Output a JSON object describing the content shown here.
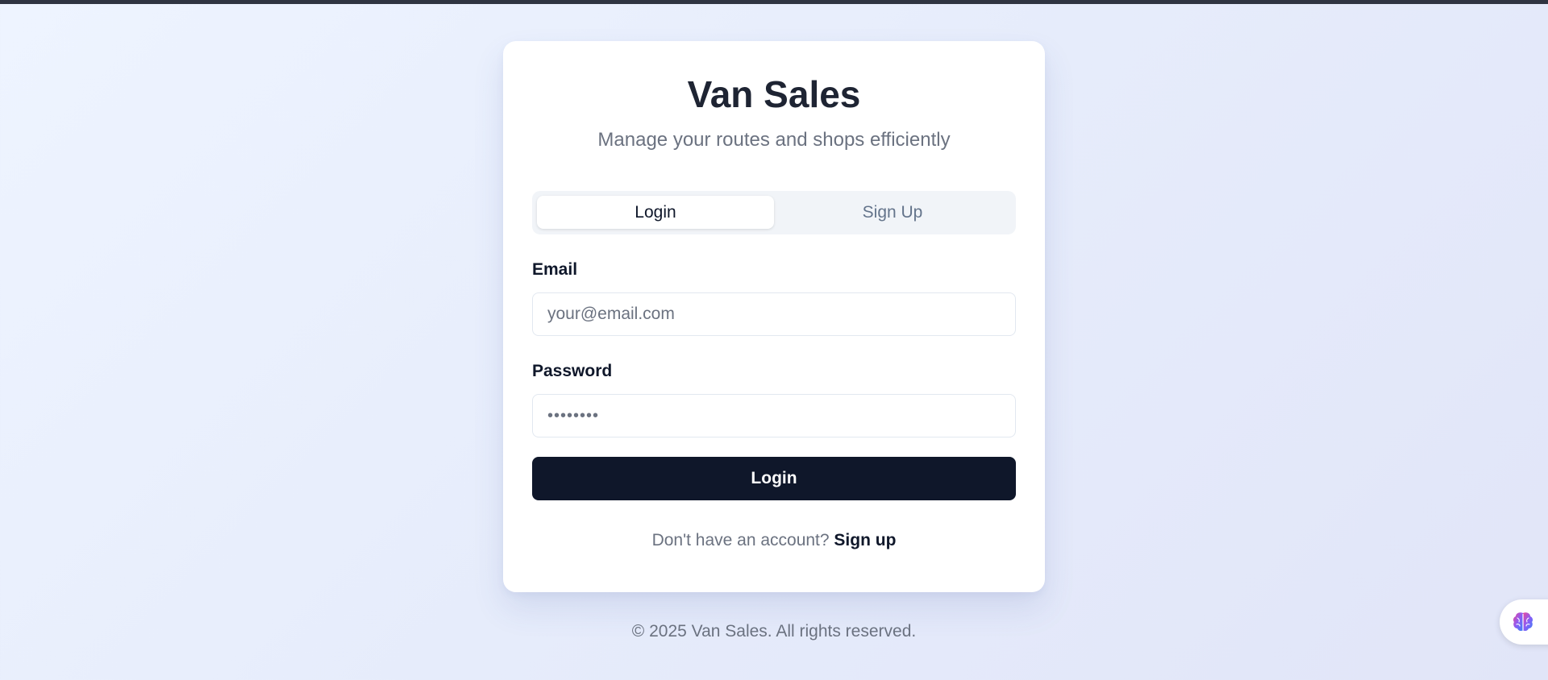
{
  "app": {
    "title": "Van Sales",
    "subtitle": "Manage your routes and shops efficiently"
  },
  "tabs": [
    {
      "label": "Login",
      "active": true
    },
    {
      "label": "Sign Up",
      "active": false
    }
  ],
  "form": {
    "email_label": "Email",
    "email_placeholder": "your@email.com",
    "email_value": "",
    "password_label": "Password",
    "password_masked": "••••••••",
    "submit_label": "Login"
  },
  "signup_prompt": {
    "text": "Don't have an account?",
    "link": "Sign up"
  },
  "footer": {
    "text": "© 2025 Van Sales. All rights reserved."
  },
  "helper": {
    "icon": "brain-icon"
  },
  "colors": {
    "primary": "#0f172a",
    "muted": "#6b7280",
    "accent_brain": "#8b5cf6"
  }
}
